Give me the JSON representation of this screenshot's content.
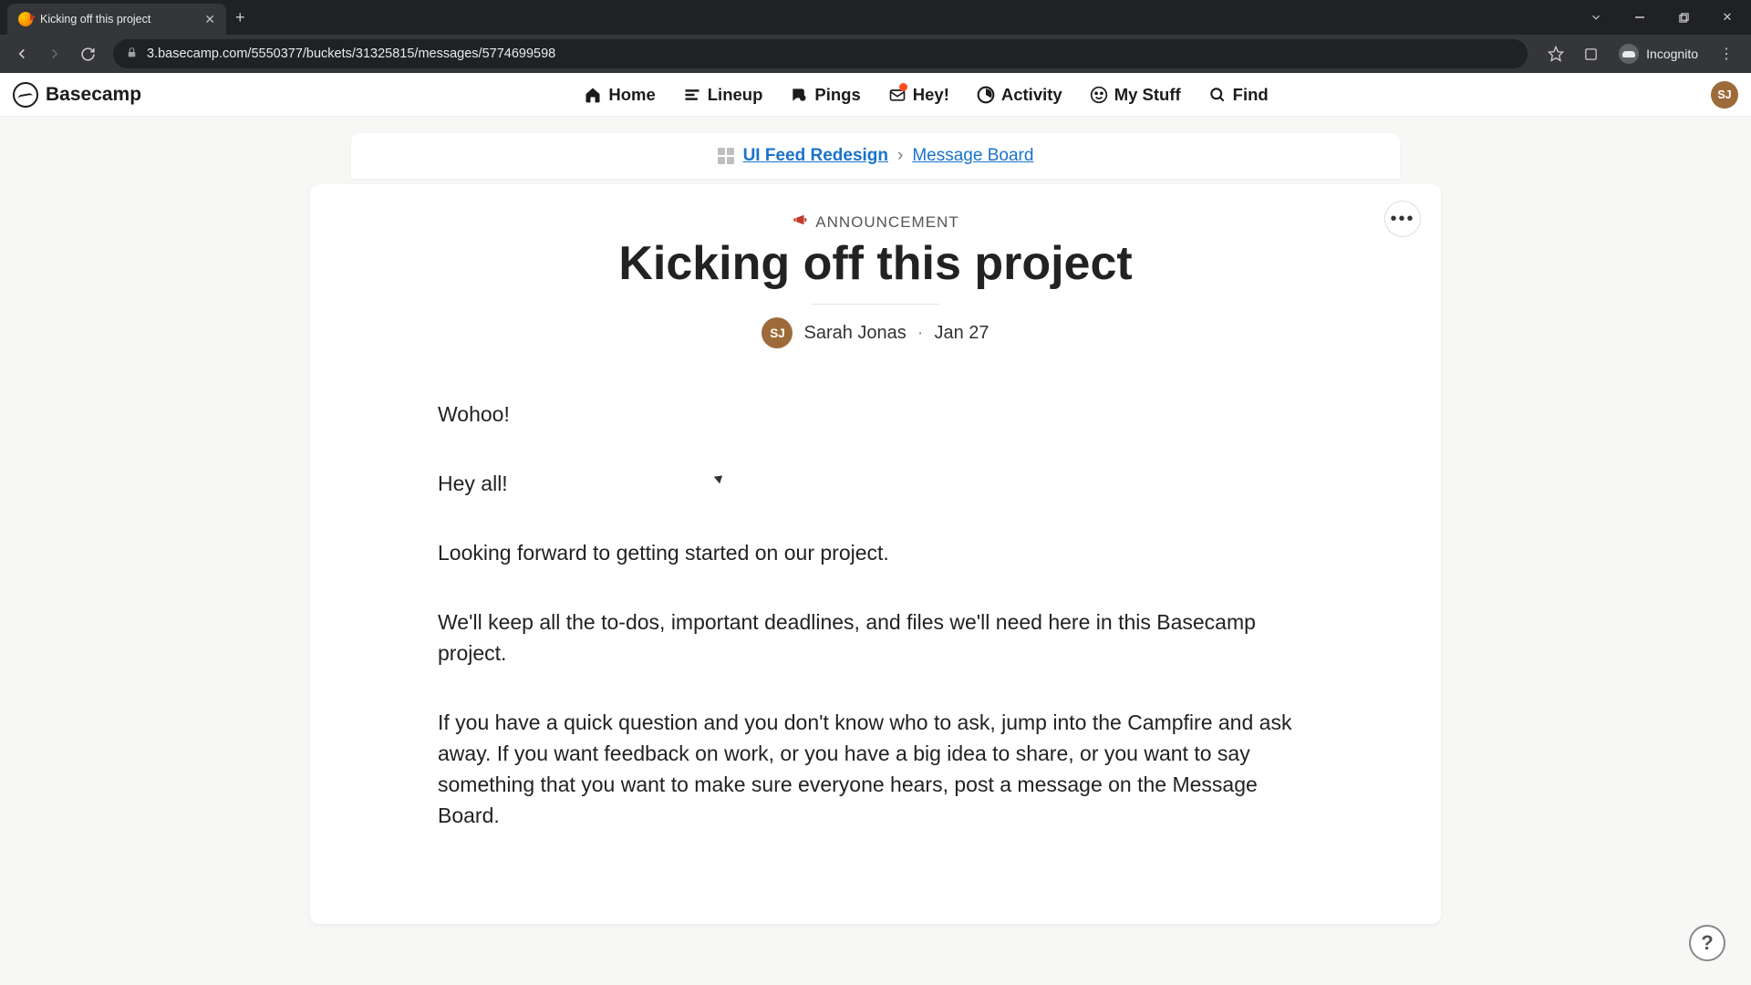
{
  "browser": {
    "tab_title": "Kicking off this project",
    "url": "3.basecamp.com/5550377/buckets/31325815/messages/5774699598",
    "incognito_label": "Incognito"
  },
  "nav": {
    "logo": "Basecamp",
    "items": [
      {
        "label": "Home"
      },
      {
        "label": "Lineup"
      },
      {
        "label": "Pings"
      },
      {
        "label": "Hey!",
        "notification": true
      },
      {
        "label": "Activity"
      },
      {
        "label": "My Stuff"
      },
      {
        "label": "Find"
      }
    ],
    "avatar_initials": "SJ"
  },
  "breadcrumb": {
    "project": "UI Feed Redesign",
    "section": "Message Board"
  },
  "message": {
    "category": "ANNOUNCEMENT",
    "title": "Kicking off this project",
    "author_initials": "SJ",
    "author_name": "Sarah Jonas",
    "date": "Jan 27",
    "paragraphs": [
      "Wohoo!",
      "Hey all!",
      "Looking forward to getting started on our project.",
      "We'll keep all the to-dos, important deadlines, and files we'll need here in this Basecamp project.",
      "If you have a quick question and you don't know who to ask, jump into the Campfire and ask away. If you want feedback on work, or you have a big idea to share, or you want to say something that you want to make sure everyone hears, post a message on the Message Board."
    ]
  },
  "help_label": "?"
}
